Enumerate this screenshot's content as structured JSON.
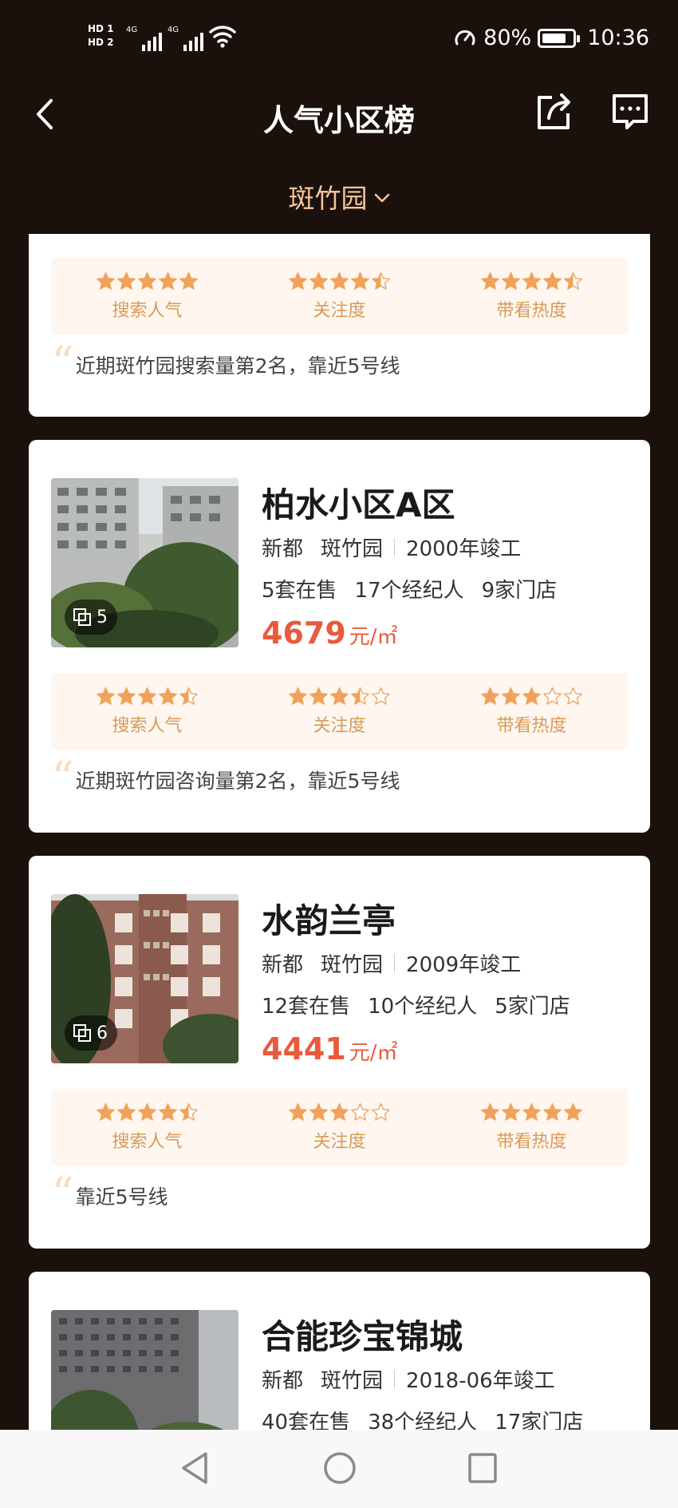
{
  "status_bar": {
    "sim1": "HD 1",
    "sim2": "HD 2",
    "net1": "4G",
    "net2": "4G",
    "battery_pct": "80%",
    "battery_level": 0.8,
    "time": "10:36"
  },
  "header": {
    "title": "人气小区榜",
    "region": "斑竹园"
  },
  "rating_labels": [
    "搜索人气",
    "关注度",
    "带看热度"
  ],
  "top_card": {
    "ratings": [
      5,
      4.5,
      4.5
    ],
    "quote": "近期斑竹园搜索量第2名，靠近5号线"
  },
  "listings": [
    {
      "name": "柏水小区A区",
      "district": "新都",
      "area": "斑竹园",
      "completed": "2000年竣工",
      "on_sale": "5套在售",
      "agents": "17个经纪人",
      "stores": "9家门店",
      "price": "4679",
      "price_unit": "元/㎡",
      "photo_count": "5",
      "ratings": [
        4.5,
        3.5,
        3
      ],
      "quote": "近期斑竹园咨询量第2名，靠近5号线"
    },
    {
      "name": "水韵兰亭",
      "district": "新都",
      "area": "斑竹园",
      "completed": "2009年竣工",
      "on_sale": "12套在售",
      "agents": "10个经纪人",
      "stores": "5家门店",
      "price": "4441",
      "price_unit": "元/㎡",
      "photo_count": "6",
      "ratings": [
        4.5,
        3,
        5
      ],
      "quote": "靠近5号线"
    },
    {
      "name": "合能珍宝锦城",
      "district": "新都",
      "area": "斑竹园",
      "completed": "2018-06年竣工",
      "on_sale": "40套在售",
      "agents": "38个经纪人",
      "stores": "17家门店"
    }
  ],
  "colors": {
    "background": "#1b110c",
    "accent_gold": "#f4c49a",
    "price_red": "#e95a3d",
    "star_fill": "#f0a25a",
    "rating_bg": "#fff6f0"
  }
}
